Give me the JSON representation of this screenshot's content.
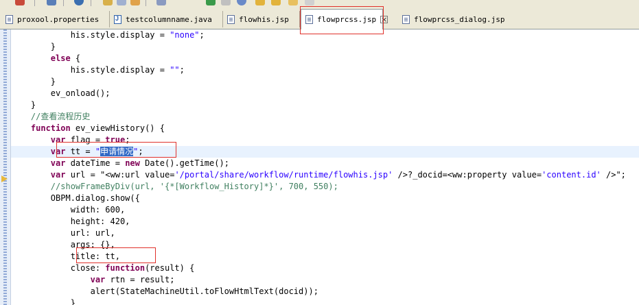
{
  "tabs": [
    {
      "label": "proxool.properties",
      "kind": "properties",
      "active": false
    },
    {
      "label": "testcolumnname.java",
      "kind": "java",
      "active": false
    },
    {
      "label": "flowhis.jsp",
      "kind": "jsp",
      "active": false
    },
    {
      "label": "flowprcss.jsp",
      "kind": "jsp",
      "active": true,
      "close": "×"
    },
    {
      "label": "flowprcss_dialog.jsp",
      "kind": "jsp",
      "active": false
    }
  ],
  "code_lines": [
    [
      {
        "t": "            his.style.display = "
      },
      {
        "t": "\"none\"",
        "c": "str"
      },
      {
        "t": ";"
      }
    ],
    [
      {
        "t": "        }"
      }
    ],
    [
      {
        "t": "        "
      },
      {
        "t": "else",
        "c": "kw"
      },
      {
        "t": " {"
      }
    ],
    [
      {
        "t": "            his.style.display = "
      },
      {
        "t": "\"\"",
        "c": "str"
      },
      {
        "t": ";"
      }
    ],
    [
      {
        "t": "        }"
      }
    ],
    [
      {
        "t": "        ev_onload();"
      }
    ],
    [
      {
        "t": "    }"
      }
    ],
    [
      {
        "t": "    "
      },
      {
        "t": "//查看流程历史",
        "c": "cmt"
      }
    ],
    [
      {
        "t": "    "
      },
      {
        "t": "function",
        "c": "kw"
      },
      {
        "t": " ev_viewHistory() {"
      }
    ],
    [
      {
        "t": "        "
      },
      {
        "t": "var",
        "c": "kw"
      },
      {
        "t": " flag = "
      },
      {
        "t": "true",
        "c": "kw"
      },
      {
        "t": ";"
      }
    ],
    [
      {
        "t": "        "
      },
      {
        "t": "var",
        "c": "kw"
      },
      {
        "t": " tt = "
      },
      {
        "t": "\"",
        "c": "str"
      },
      {
        "t": "申请情况",
        "c": "sel"
      },
      {
        "t": "\"",
        "c": "str"
      },
      {
        "t": ";"
      }
    ],
    [
      {
        "t": "        "
      },
      {
        "t": "var",
        "c": "kw"
      },
      {
        "t": " dateTime = "
      },
      {
        "t": "new",
        "c": "kw"
      },
      {
        "t": " Date().getTime();"
      }
    ],
    [
      {
        "t": "        "
      },
      {
        "t": "var",
        "c": "kw"
      },
      {
        "t": " url = \"<ww:url value="
      },
      {
        "t": "'/portal/share/workflow/runtime/flowhis.jsp'",
        "c": "str"
      },
      {
        "t": " />?_docid=<ww:property value="
      },
      {
        "t": "'content.id'",
        "c": "str"
      },
      {
        "t": " />\";"
      }
    ],
    [
      {
        "t": "        "
      },
      {
        "t": "//showFrameByDiv(url, '{*[Workflow_History]*}', 700, 550);",
        "c": "cmt"
      }
    ],
    [
      {
        "t": "        OBPM.dialog.show({"
      }
    ],
    [
      {
        "t": "            width: 600,"
      }
    ],
    [
      {
        "t": "            height: 420,"
      }
    ],
    [
      {
        "t": "            url: url,"
      }
    ],
    [
      {
        "t": "            args: {},"
      }
    ],
    [
      {
        "t": "            title: tt,"
      }
    ],
    [
      {
        "t": "            close: "
      },
      {
        "t": "function",
        "c": "kw"
      },
      {
        "t": "(result) {"
      }
    ],
    [
      {
        "t": "                "
      },
      {
        "t": "var",
        "c": "kw"
      },
      {
        "t": " rtn = result;"
      }
    ],
    [
      {
        "t": "                alert(StateMachineUtil.toFlowHtmlText(docid));"
      }
    ],
    [
      {
        "t": "            }"
      }
    ]
  ],
  "current_line_index": 10,
  "colors": {
    "keyword": "#7f0055",
    "string": "#2a00ff",
    "comment": "#3f7f5f",
    "selection": "#3169c6",
    "annotation": "#e0302a"
  },
  "icons": [
    "file-icon",
    "java-file-icon",
    "close-icon",
    "instruction-pointer-icon"
  ]
}
